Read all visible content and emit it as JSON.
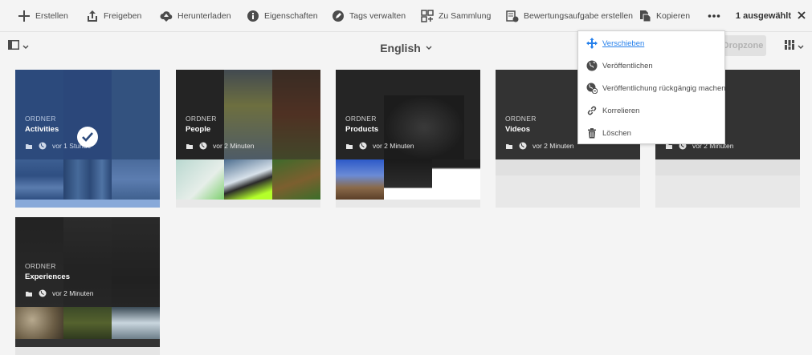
{
  "toolbar": {
    "create": "Erstellen",
    "share": "Freigeben",
    "download": "Herunterladen",
    "properties": "Eigenschaften",
    "manage_tags": "Tags verwalten",
    "to_collection": "Zu Sammlung",
    "review_task": "Bewertungsaufgabe erstellen",
    "copy": "Kopieren",
    "selection_count": "1 ausgewählt"
  },
  "header": {
    "title": "English",
    "dropzone_label": "Dropzone"
  },
  "menu": {
    "items": [
      {
        "label": "Verschieben",
        "icon": "move-icon"
      },
      {
        "label": "Veröffentlichen",
        "icon": "globe-icon"
      },
      {
        "label": "Veröffentlichung rückgängig machen",
        "icon": "globe-unpublish-icon"
      },
      {
        "label": "Korrelieren",
        "icon": "link-icon"
      },
      {
        "label": "Löschen",
        "icon": "trash-icon"
      }
    ]
  },
  "cards": [
    {
      "kind": "ORDNER",
      "name": "Activities",
      "time": "vor 1 Stunde",
      "selected": true
    },
    {
      "kind": "ORDNER",
      "name": "People",
      "time": "vor 2 Minuten"
    },
    {
      "kind": "ORDNER",
      "name": "Products",
      "time": "vor 2 Minuten"
    },
    {
      "kind": "ORDNER",
      "name": "Videos",
      "time": "vor 2 Minuten"
    },
    {
      "kind": "ORDNER",
      "name": "",
      "time": "vor 2 Minuten"
    },
    {
      "kind": "ORDNER",
      "name": "Experiences",
      "time": "vor 2 Minuten"
    }
  ],
  "colors": {
    "accent": "#2680eb",
    "selected_card": "#2c4a7c",
    "toolbar_bg": "#f4f4f4",
    "card_dark": "#333333"
  }
}
